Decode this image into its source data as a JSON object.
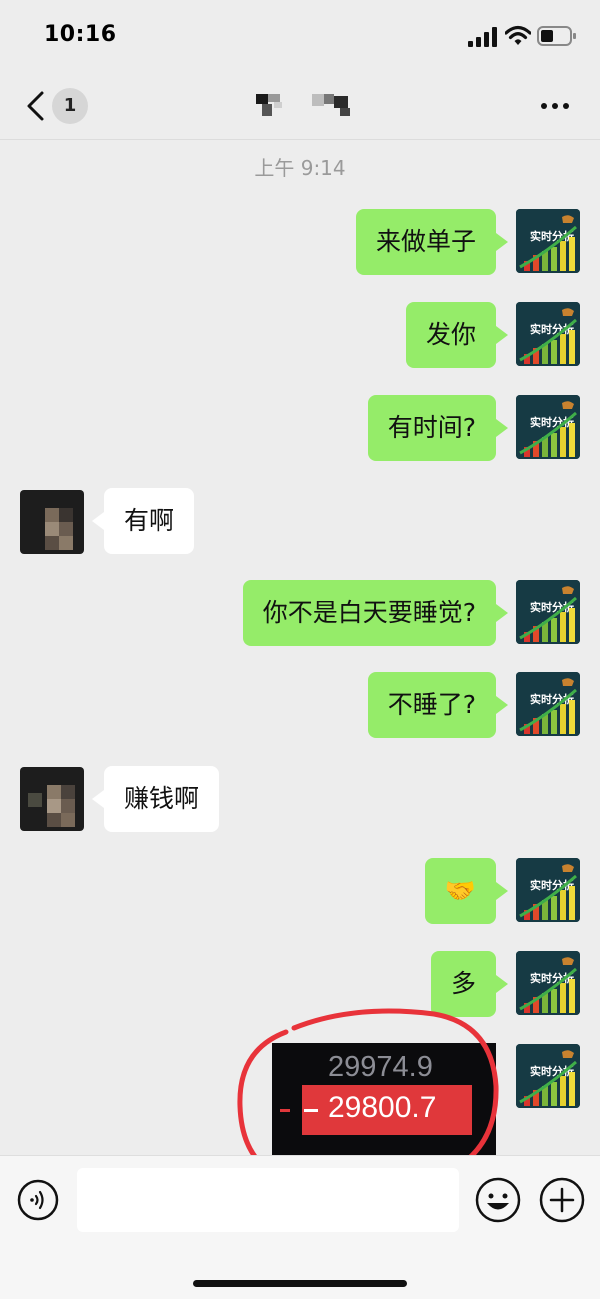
{
  "status_bar": {
    "time": "10:16"
  },
  "nav": {
    "unread_count": "1"
  },
  "timestamp": "上午 9:14",
  "messages": [
    {
      "sender": "self",
      "text": "来做单子"
    },
    {
      "sender": "self",
      "text": "发你"
    },
    {
      "sender": "self",
      "text": "有时间?"
    },
    {
      "sender": "peer",
      "text": "有啊"
    },
    {
      "sender": "self",
      "text": "你不是白天要睡觉?"
    },
    {
      "sender": "self",
      "text": "不睡了?"
    },
    {
      "sender": "peer",
      "text": "赚钱啊"
    },
    {
      "sender": "self",
      "text": "🤝"
    },
    {
      "sender": "self",
      "text": "多"
    }
  ],
  "image_message": {
    "price_high": "29974.9",
    "price_current": "29800.7",
    "highlight_color": "#e0383b"
  },
  "self_avatar_text": "实时分析",
  "colors": {
    "self_bubble": "#95ec69",
    "peer_bubble": "#ffffff",
    "background": "#ededed",
    "annotation_circle": "#e8333a"
  },
  "icons": [
    "back-icon",
    "more-icon",
    "voice-icon",
    "emoji-icon",
    "plus-icon",
    "signal-icon",
    "wifi-icon",
    "battery-icon"
  ]
}
